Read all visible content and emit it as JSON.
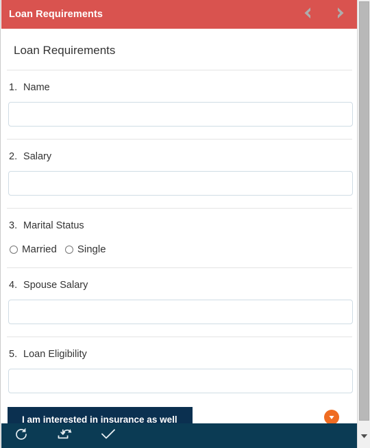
{
  "titlebar": {
    "title": "Loan Requirements",
    "prev_icon": "chevron-left-icon",
    "next_icon": "chevron-right-icon",
    "bg_color": "#d9534f"
  },
  "form": {
    "heading": "Loan Requirements",
    "questions": [
      {
        "number": "1.",
        "label": "Name",
        "type": "text",
        "value": "",
        "placeholder": ""
      },
      {
        "number": "2.",
        "label": "Salary",
        "type": "text",
        "value": "",
        "placeholder": ""
      },
      {
        "number": "3.",
        "label": "Marital Status",
        "type": "radio",
        "options": [
          {
            "label": "Married",
            "checked": false
          },
          {
            "label": "Single",
            "checked": false
          }
        ]
      },
      {
        "number": "4.",
        "label": "Spouse Salary",
        "type": "text",
        "value": "",
        "placeholder": ""
      },
      {
        "number": "5.",
        "label": "Loan Eligibility",
        "type": "text",
        "value": "",
        "placeholder": ""
      }
    ],
    "cta": {
      "label": "I am interested in insurance as well",
      "bg_color": "#0b3050",
      "text_color": "#ffffff"
    },
    "dropdown_toggle": {
      "icon": "caret-down-icon",
      "bg_color": "#ef6c22"
    }
  },
  "toolbar": {
    "bg_color": "#0b3b54",
    "buttons": [
      {
        "name": "refresh-icon",
        "label": "Refresh"
      },
      {
        "name": "restore-icon",
        "label": "Restore"
      },
      {
        "name": "check-icon",
        "label": "Submit"
      }
    ]
  },
  "scrollbar": {
    "orientation": "vertical",
    "down_arrow_icon": "caret-down-icon",
    "thumb_color": "#b8b8b8"
  }
}
